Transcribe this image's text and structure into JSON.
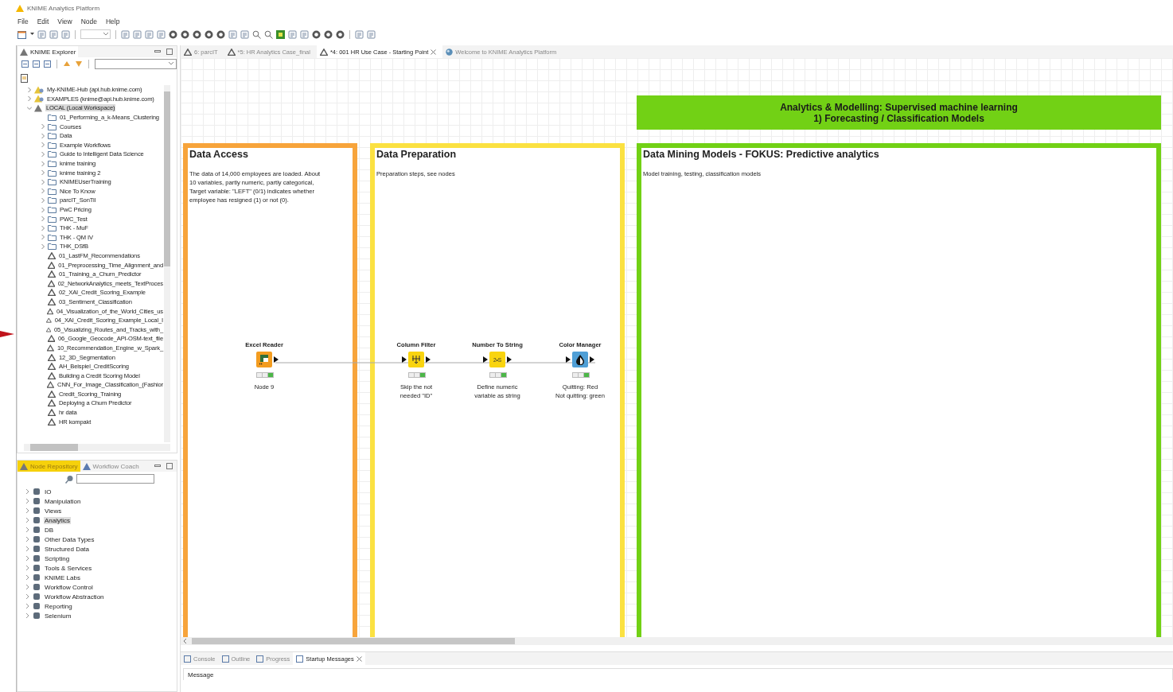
{
  "window": {
    "title": "KNIME Analytics Platform"
  },
  "menu": [
    "File",
    "Edit",
    "View",
    "Node",
    "Help"
  ],
  "explorer": {
    "title": "KNIME Explorer",
    "tree": [
      {
        "label": "My-KNIME-Hub (api.hub.knime.com)",
        "kind": "hub",
        "expanded": false,
        "selected": false
      },
      {
        "label": "EXAMPLES (knime@api.hub.knime.com)",
        "kind": "hub",
        "expanded": false,
        "selected": false
      },
      {
        "label": "LOCAL (Local Workspace)",
        "kind": "local",
        "expanded": true,
        "selected": true,
        "children": [
          {
            "label": "01_Performing_a_k-Means_Clustering",
            "kind": "folder",
            "expandable": false
          },
          {
            "label": "Courses",
            "kind": "folder",
            "expandable": true
          },
          {
            "label": "Data",
            "kind": "folder",
            "expandable": true
          },
          {
            "label": "Example Workflows",
            "kind": "folder",
            "expandable": true
          },
          {
            "label": "Guide to Intelligent Data Science",
            "kind": "folder",
            "expandable": true
          },
          {
            "label": "knime training",
            "kind": "folder",
            "expandable": true
          },
          {
            "label": "knime training 2",
            "kind": "folder",
            "expandable": true
          },
          {
            "label": "KNIMEUserTraining",
            "kind": "folder",
            "expandable": true
          },
          {
            "label": "Nice To Know",
            "kind": "folder",
            "expandable": true
          },
          {
            "label": "parcIT_SonTil",
            "kind": "folder",
            "expandable": true
          },
          {
            "label": "PwC Pricing",
            "kind": "folder",
            "expandable": true
          },
          {
            "label": "PWC_Test",
            "kind": "folder",
            "expandable": true
          },
          {
            "label": "THK - MuF",
            "kind": "folder",
            "expandable": true
          },
          {
            "label": "THK - QM IV",
            "kind": "folder",
            "expandable": true
          },
          {
            "label": "THK_DSfB",
            "kind": "folder",
            "expandable": true
          },
          {
            "label": "01_LastFM_Recommendations",
            "kind": "workflow"
          },
          {
            "label": "01_Preprocessing_Time_Alignment_and",
            "kind": "workflow"
          },
          {
            "label": "01_Training_a_Churn_Predictor",
            "kind": "workflow"
          },
          {
            "label": "02_NetworkAnalytics_meets_TextProces",
            "kind": "workflow"
          },
          {
            "label": "02_XAI_Credit_Scoring_Example",
            "kind": "workflow"
          },
          {
            "label": "03_Sentiment_Classification",
            "kind": "workflow"
          },
          {
            "label": "04_Visualization_of_the_World_Cities_us",
            "kind": "workflow"
          },
          {
            "label": "04_XAI_Credit_Scoring_Example_Local_I",
            "kind": "workflow"
          },
          {
            "label": "05_Visualizing_Routes_and_Tracks_with_",
            "kind": "workflow"
          },
          {
            "label": "06_Google_Geocode_API-OSM-text_file",
            "kind": "workflow"
          },
          {
            "label": "10_Recommendation_Engine_w_Spark_",
            "kind": "workflow"
          },
          {
            "label": "12_3D_Segmentation",
            "kind": "workflow"
          },
          {
            "label": "AH_Beispiel_CreditScoring",
            "kind": "workflow"
          },
          {
            "label": "Building a Credit Scoring Model",
            "kind": "workflow"
          },
          {
            "label": "CNN_For_Image_Classification_(Fashior",
            "kind": "workflow"
          },
          {
            "label": "Credit_Scoring_Training",
            "kind": "workflow"
          },
          {
            "label": "Deploying a Churn Predictor",
            "kind": "workflow"
          },
          {
            "label": "hr data",
            "kind": "workflow"
          },
          {
            "label": "HR kompakt",
            "kind": "workflow"
          }
        ]
      }
    ]
  },
  "repository": {
    "tabs": [
      {
        "label": "Node Repository",
        "selected": true
      },
      {
        "label": "Workflow Coach",
        "selected": false
      }
    ],
    "categories": [
      {
        "label": "IO",
        "selected": false
      },
      {
        "label": "Manipulation",
        "selected": false
      },
      {
        "label": "Views",
        "selected": false
      },
      {
        "label": "Analytics",
        "selected": true
      },
      {
        "label": "DB",
        "selected": false
      },
      {
        "label": "Other Data Types",
        "selected": false
      },
      {
        "label": "Structured Data",
        "selected": false
      },
      {
        "label": "Scripting",
        "selected": false
      },
      {
        "label": "Tools & Services",
        "selected": false
      },
      {
        "label": "KNIME Labs",
        "selected": false
      },
      {
        "label": "Workflow Control",
        "selected": false
      },
      {
        "label": "Workflow Abstraction",
        "selected": false
      },
      {
        "label": "Reporting",
        "selected": false
      },
      {
        "label": "Selenium",
        "selected": false
      }
    ]
  },
  "editor_tabs": [
    {
      "label": "6: parcIT",
      "selected": false,
      "kind": "workflow"
    },
    {
      "label": "*5: HR Analytics Case_final",
      "selected": false,
      "kind": "workflow"
    },
    {
      "label": "*4: 001 HR Use Case - Starting Point",
      "selected": true,
      "kind": "workflow",
      "closable": true
    },
    {
      "label": "Welcome to KNIME Analytics Platform",
      "selected": false,
      "kind": "web"
    }
  ],
  "annotations": [
    {
      "kind": "banner",
      "color": "#72d115",
      "lines": [
        "Analytics & Modelling: Supervised machine learning",
        "1) Forecasting / Classification Models"
      ]
    },
    {
      "kind": "box",
      "color": "#f7a43b",
      "title": "Data Access",
      "text": "The data of 14,000 employees are loaded. About\n10 variables, partly numeric, partly categorical,\nTarget variable: \"LEFT\" (0/1) indicates whether\nemployee has resigned (1) or not (0)."
    },
    {
      "kind": "box",
      "color": "#fbe141",
      "title": "Data Preparation",
      "text": "Preparation steps, see nodes"
    },
    {
      "kind": "box",
      "color": "#72d115",
      "title": "Data Mining Models - FOKUS: Predictive analytics",
      "text": "Model training, testing, classification models"
    }
  ],
  "nodes": [
    {
      "name": "Excel Reader",
      "kind": "source",
      "executed": true,
      "comment": "Node 9"
    },
    {
      "name": "Column Filter",
      "kind": "manipulator",
      "executed": true,
      "comment": "Skip the not\nneeded  \"ID\""
    },
    {
      "name": "Number To String",
      "kind": "manipulator",
      "executed": true,
      "comment": "Define numeric\nvariable as string",
      "icon_text": "2•S"
    },
    {
      "name": "Color Manager",
      "kind": "visualizer",
      "executed": true,
      "comment": "Quitting: Red\nNot quitting: green"
    }
  ],
  "bottom": {
    "tabs": [
      {
        "label": "Console",
        "selected": false
      },
      {
        "label": "Outline",
        "selected": false
      },
      {
        "label": "Progress",
        "selected": false
      },
      {
        "label": "Startup Messages",
        "selected": true,
        "closable": true
      }
    ],
    "column": "Message"
  }
}
